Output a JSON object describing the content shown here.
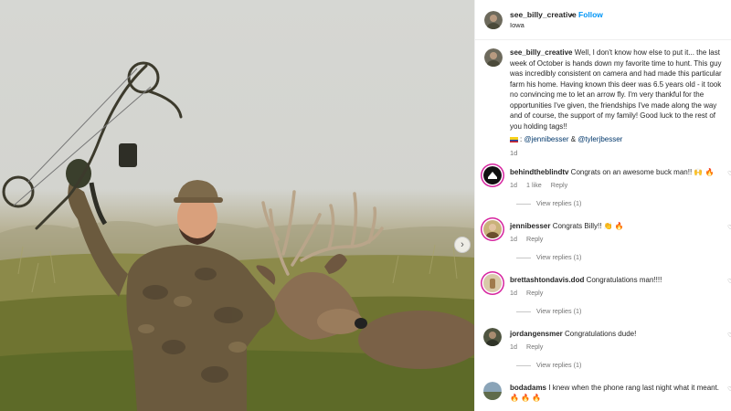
{
  "post": {
    "username": "see_billy_creative",
    "dot": "•",
    "follow_label": "Follow",
    "location": "Iowa",
    "caption_text": "Well, I don't know how else to put it... the last week of October is hands down my favorite time to hunt. This guy was incredibly consistent on camera and had made this particular farm his home. Having known this deer was 6.5 years old - it took no convincing me to let an arrow fly. I'm very thankful for the opportunities I've given, the friendships I've made along the way and of course, the support of my family! Good luck to the rest of you holding tags!!",
    "tag1": "@jennibesser",
    "amp": "&",
    "tag2": "@tylerjbesser",
    "time": "1d",
    "image_icon": "carousel-next-icon"
  },
  "comments": [
    {
      "user": "behindtheblindtv",
      "text": "Congrats on an awesome buck man!!",
      "emoji": "🙌 🔥",
      "time": "1d",
      "likes": "1 like",
      "reply": "Reply",
      "replies": "View replies (1)"
    },
    {
      "user": "jennibesser",
      "text": "Congrats Billy!!",
      "emoji": "👏 🔥",
      "time": "1d",
      "reply": "Reply",
      "replies": "View replies (1)"
    },
    {
      "user": "brettashtondavis.dod",
      "text": "Congratulations man!!!!",
      "time": "1d",
      "reply": "Reply",
      "replies": "View replies (1)"
    },
    {
      "user": "jordangensmer",
      "text": "Congratulations dude!",
      "time": "1d",
      "reply": "Reply",
      "replies": "View replies (1)"
    },
    {
      "user": "bodadams",
      "text": "I knew when the phone rang last night what it meant.",
      "emoji": "🔥 🔥 🔥"
    }
  ],
  "colors": {
    "link": "#0095f6",
    "muted": "#737373",
    "story_ring": "#d6249f"
  }
}
